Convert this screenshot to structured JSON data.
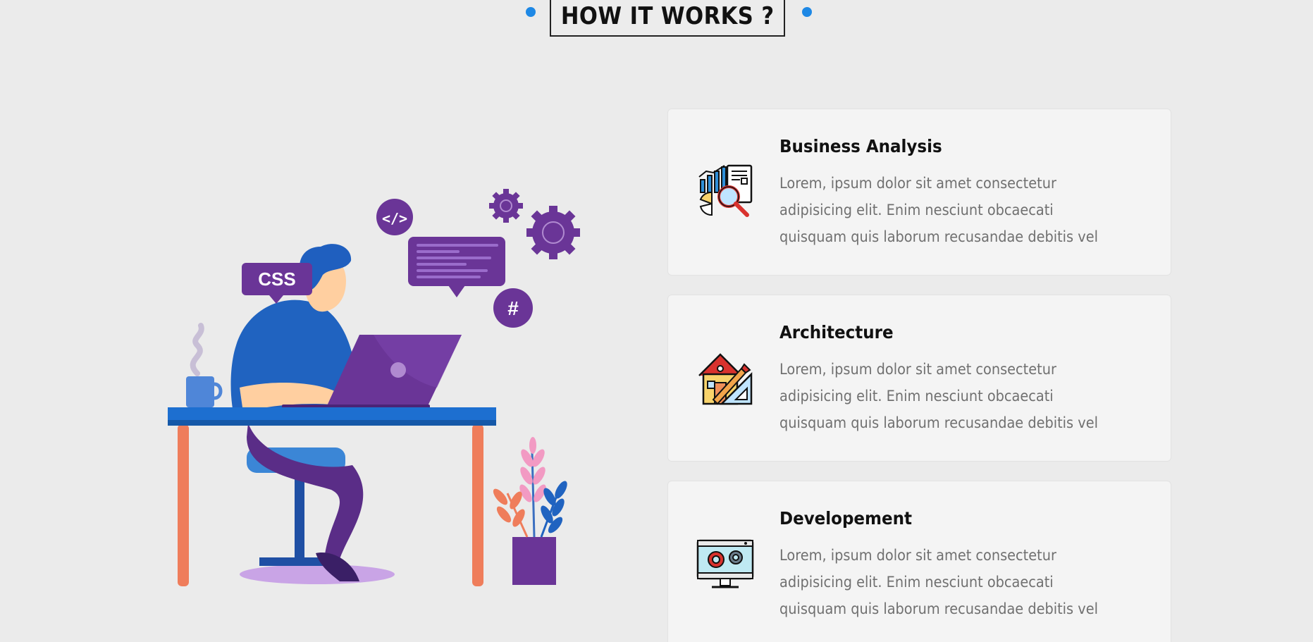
{
  "section": {
    "heading": "HOW IT WORKS ?"
  },
  "illustration": {
    "css_bubble": "CSS",
    "code_badge": "</>",
    "hash_badge": "#"
  },
  "cards": [
    {
      "title": "Business Analysis",
      "description": "Lorem, ipsum dolor sit amet consectetur adipisicing elit. Enim nesciunt obcaecati quisquam quis laborum recusandae debitis vel",
      "icon": "business-analysis-icon"
    },
    {
      "title": "Architecture",
      "description": "Lorem, ipsum dolor sit amet consectetur adipisicing elit. Enim nesciunt obcaecati quisquam quis laborum recusandae debitis vel",
      "icon": "architecture-icon"
    },
    {
      "title": "Developement",
      "description": "Lorem, ipsum dolor sit amet consectetur adipisicing elit. Enim nesciunt obcaecati quisquam quis laborum recusandae debitis vel",
      "icon": "development-icon"
    }
  ],
  "colors": {
    "accent_dot": "#1e88e5",
    "purple": "#6a3597",
    "blue": "#1f5fbf",
    "background": "#ebebeb",
    "card": "#f4f4f4"
  }
}
